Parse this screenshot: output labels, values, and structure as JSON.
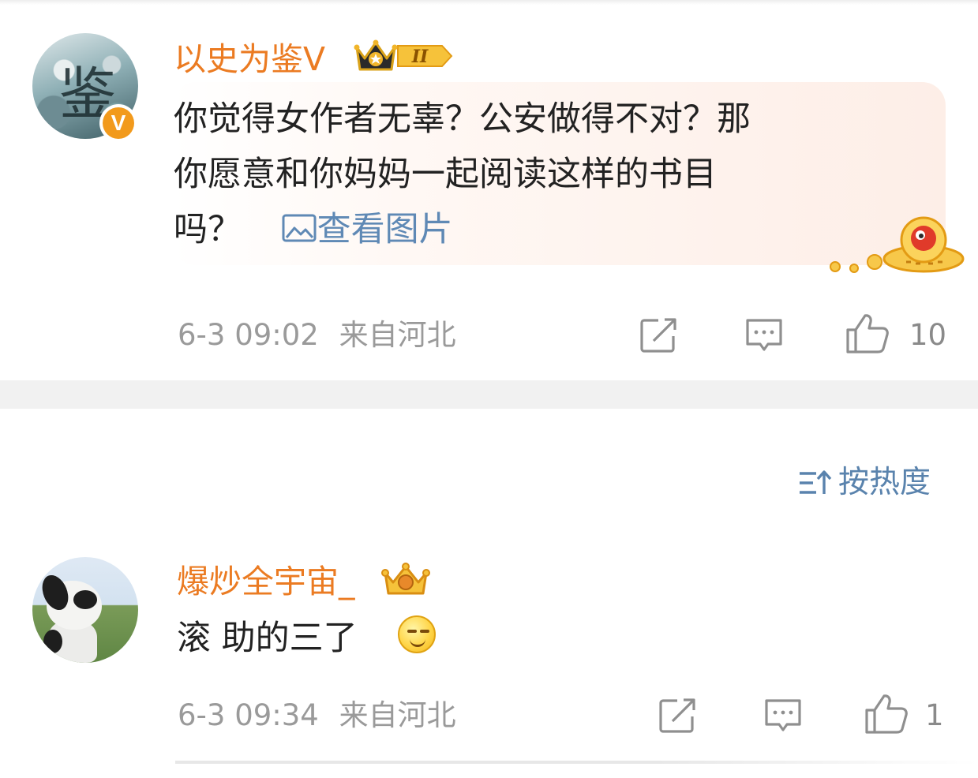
{
  "comments": [
    {
      "username": "以史为鉴V",
      "avatar_glyph": "鉴",
      "verified_badge": "V",
      "level_badge": "II",
      "content_lines": [
        "你觉得女作者无辜？公安做得不对？那",
        "你愿意和你妈妈一起阅读这样的书目",
        "吗？"
      ],
      "view_image_label": "查看图片",
      "time": "6-3 09:02",
      "location": "来自河北",
      "like_count": "10"
    },
    {
      "username": "爆炒全宇宙_",
      "content": "滚 助的三了",
      "time": "6-3 09:34",
      "location": "来自河北",
      "like_count": "1"
    }
  ],
  "sort": {
    "label": "按热度"
  },
  "icons": {
    "repost": "repost-icon",
    "comment": "comment-icon",
    "like": "like-icon",
    "image": "image-icon",
    "sort": "sort-icon",
    "crown": "crown-badge-icon",
    "ufo_mascot": "ufo-mascot-icon",
    "emoji": "smile-emoji-icon"
  },
  "colors": {
    "username": "#eb7b22",
    "link": "#5f89b5",
    "meta": "#9a9a9a",
    "verified": "#f29a1c"
  }
}
